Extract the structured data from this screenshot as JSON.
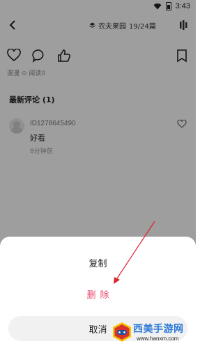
{
  "status_bar": {
    "time": "3:43"
  },
  "header": {
    "book_name": "农夫果园",
    "chapter_progress": "19/24篇"
  },
  "meta": {
    "text": "渡漫  ⊙  阅读0"
  },
  "comments": {
    "title": "最新评论 (1)",
    "items": [
      {
        "user": "ID1278645490",
        "text": "好看",
        "time": "8分钟前"
      }
    ]
  },
  "action_sheet": {
    "copy_label": "复制",
    "delete_label": "删除",
    "cancel_label": "取消"
  },
  "watermark": {
    "title": "西美手游网",
    "url": "www.hanxm.com"
  },
  "colors": {
    "delete": "#e94b6e",
    "arrow": "#e0232f",
    "watermark": "#2b79d6"
  }
}
